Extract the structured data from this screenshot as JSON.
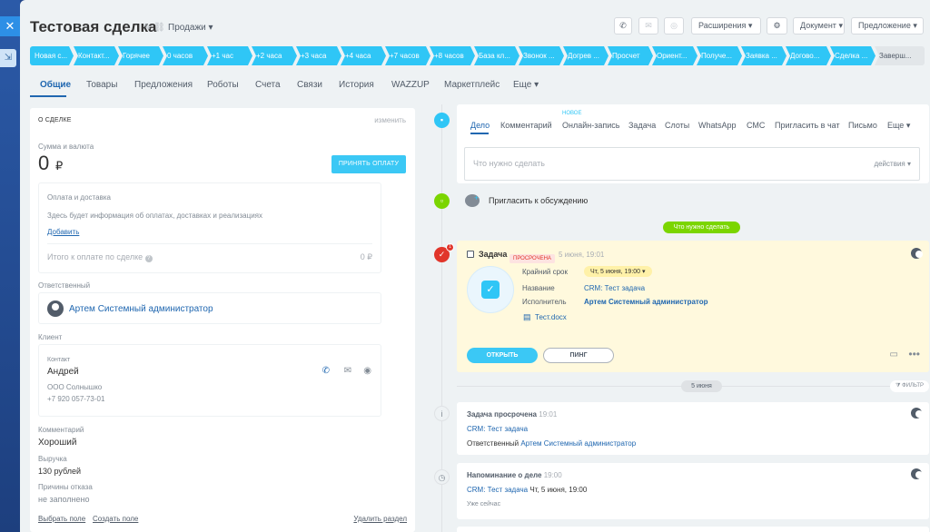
{
  "colors": {
    "accent": "#2fc6f6",
    "link": "#2067b0",
    "overdue": "#e1352a",
    "todo_label": "#7bd500"
  },
  "header": {
    "title": "Тестовая сделка",
    "funnel": "Продажи",
    "buttons": {
      "extensions": "Расширения",
      "document": "Документ",
      "proposal": "Предложение"
    }
  },
  "stages": [
    "Новая с...",
    "Контакт...",
    "Горячее",
    "0 часов",
    "+1 час",
    "+2 часа",
    "+3 часа",
    "+4 часа",
    "+7 часов",
    "+8 часов",
    "База кл...",
    "Звонок ...",
    "Догрев ...",
    "Просчет",
    "Ориент...",
    "Получе...",
    "Заявка ...",
    "Догово...",
    "Сделка ...",
    "Заверш..."
  ],
  "tabs": [
    "Общие",
    "Товары",
    "Предложения",
    "Роботы",
    "Счета",
    "Связи",
    "История",
    "WAZZUP",
    "Маркетплейс",
    "Еще"
  ],
  "deal": {
    "section_title": "О СДЕЛКЕ",
    "change_link": "изменить",
    "sum_label": "Сумма и валюта",
    "amount": "0",
    "currency": "₽",
    "pay_button": "ПРИНЯТЬ ОПЛАТУ",
    "payment_title": "Оплата и доставка",
    "payment_text": "Здесь будет информация об оплатах, доставках и реализациях",
    "add_link": "Добавить",
    "total_label": "Итого к оплате по сделке",
    "total_value": "0 ₽",
    "responsible_label": "Ответственный",
    "responsible_name": "Артем Системный администратор",
    "client_label": "Клиент",
    "contact_label": "Контакт",
    "contact_name": "Андрей",
    "company": "ООО Солнышко",
    "phone": "+7 920 057-73-01",
    "comment_label": "Комментарий",
    "comment_value": "Хороший",
    "revenue_label": "Выручка",
    "revenue_value": "130 рублей",
    "loss_reason_label": "Причины отказа",
    "loss_reason_value": "не заполнено",
    "choose_field": "Выбрать поле",
    "create_field": "Создать поле",
    "delete_section": "Удалить раздел"
  },
  "editor": {
    "tabs": [
      "Дело",
      "Комментарий",
      "Онлайн-запись",
      "Задача",
      "Слоты",
      "WhatsApp",
      "СМС",
      "Пригласить в чат",
      "Письмо",
      "Еще"
    ],
    "new_badge": "НОВОЕ",
    "placeholder": "Что нужно сделать",
    "actions": "действия"
  },
  "invite": "Пригласить к обсуждению",
  "todo_label": "Что нужно сделать",
  "task": {
    "badge_count": "1",
    "title": "Задача",
    "status": "ПРОСРОЧЕНА",
    "date": "5 июня, 19:01",
    "deadline_label": "Крайний срок",
    "deadline_value": "Чт, 5 июня, 19:00",
    "name_label": "Название",
    "name_value": "CRM: Тест задача",
    "executor_label": "Исполнитель",
    "executor_value": "Артем Системный администратор",
    "file": "Тест.docx",
    "open_button": "ОТКРЫТЬ",
    "ping_button": "ПИНГ"
  },
  "date_sep": "5 июня",
  "filter": "ФИЛЬТР",
  "history": [
    {
      "title": "Задача просрочена",
      "time": "19:01",
      "link": "CRM: Тест задача",
      "line_label": "Ответственный",
      "line_value": "Артем Системный администратор"
    },
    {
      "title": "Напоминание о деле",
      "time": "19:00",
      "link": "CRM: Тест задача",
      "line_value": "Чт, 5 июня, 19:00",
      "note": "Уже сейчас"
    }
  ]
}
